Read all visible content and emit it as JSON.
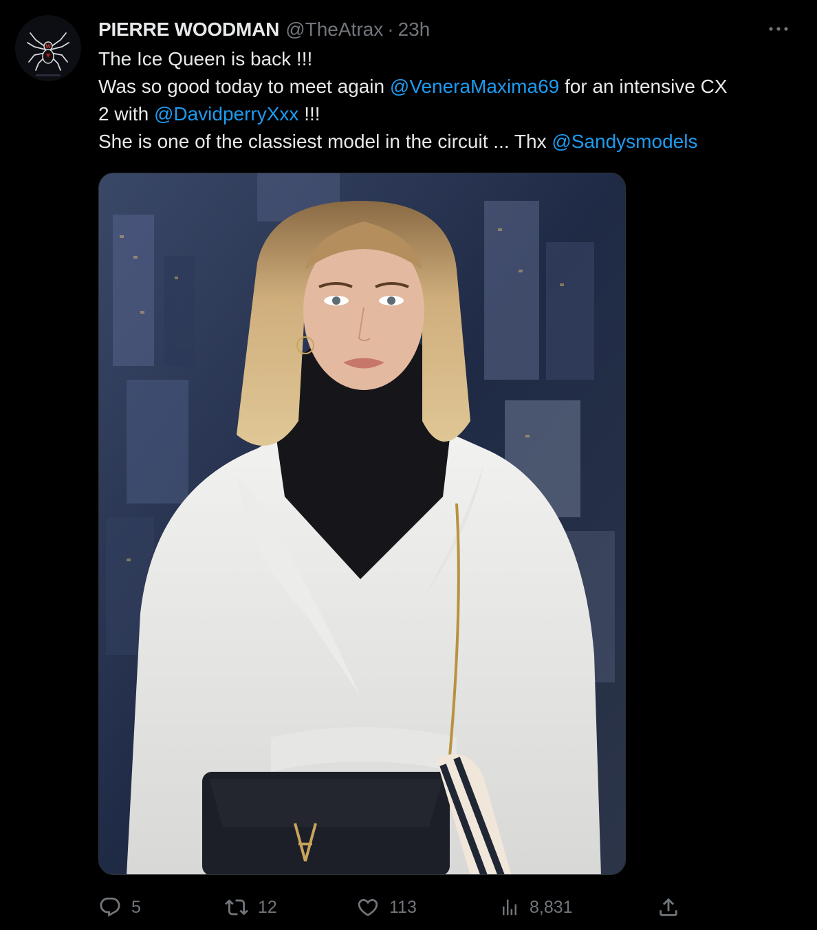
{
  "author": {
    "display_name": "PIERRE WOODMAN",
    "handle": "@TheAtrax",
    "separator": "·",
    "time": "23h"
  },
  "tweet": {
    "line1": "The Ice Queen is back !!!",
    "line2_a": "Was so good today to meet again ",
    "line2_mention": "@VeneraMaxima69",
    "line2_b": " for an intensive CX",
    "line3_a": "2 with ",
    "line3_mention": "@DavidperryXxx",
    "line3_b": " !!!",
    "line4_a": "She is one of the classiest model in the circuit ... Thx ",
    "line4_mention": "@Sandysmodels"
  },
  "actions": {
    "replies": "5",
    "retweets": "12",
    "likes": "113",
    "views": "8,831"
  },
  "icons": {
    "more": "more-horizontal-icon",
    "reply": "reply-icon",
    "retweet": "retweet-icon",
    "like": "heart-icon",
    "views": "views-chart-icon",
    "share": "share-icon"
  },
  "colors": {
    "background": "#000000",
    "text": "#e7e9ea",
    "secondary": "#71767b",
    "link": "#1d9bf0"
  }
}
